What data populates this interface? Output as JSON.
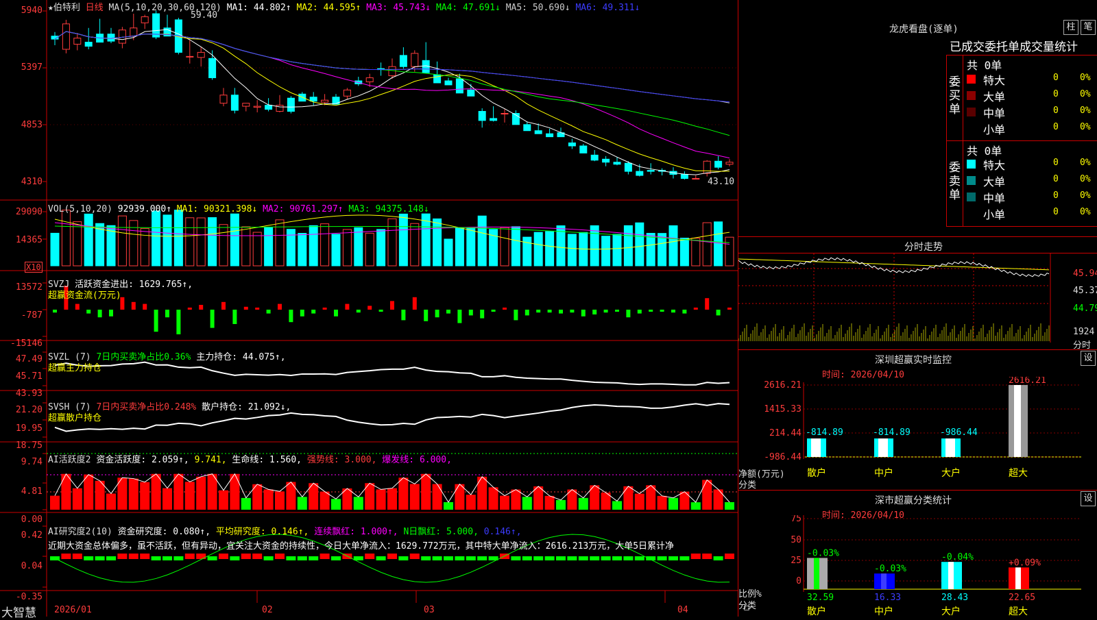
{
  "stock": {
    "name": "★伯特利",
    "period": "日线",
    "star": "★"
  },
  "panel_ma": {
    "title": "MA(5,10,20,30,60,120)",
    "ma1": "MA1: 44.802↑",
    "ma2": "MA2: 44.595↑",
    "ma3": "MA3: 45.743↓",
    "ma4": "MA4: 47.691↓",
    "ma5": "MA5: 50.690↓",
    "ma6": "MA6: 49.311↓",
    "axis": [
      "5940",
      "5397",
      "4853",
      "4310"
    ],
    "high_label": "59.40",
    "low_label": "43.10"
  },
  "panel_vol": {
    "title": "VOL(5,10,20)",
    "value": "92939.000↑",
    "ma1": "MA1: 90321.398↓",
    "ma2": "MA2: 90761.297↑",
    "ma3": "MA3: 94375.148↓",
    "axis": [
      "29090",
      "14365"
    ],
    "unit": "X10"
  },
  "panel_svzj": {
    "title": "SVZJ",
    "label": "活跃资金进出: 1629.765↑,",
    "sub": "超赢资金流(万元)",
    "axis": [
      "13572",
      "-787",
      "-15146"
    ]
  },
  "panel_svzl": {
    "title": "SVZL (7)",
    "l1": "7日内买卖净占比0.36%",
    "l2": "主力持仓: 44.075↑,",
    "sub": "超赢主力持仓",
    "axis": [
      "47.49",
      "45.71",
      "43.93"
    ]
  },
  "panel_svsh": {
    "title": "SVSH (7)",
    "l1": "7日内买卖净占比0.248%",
    "l2": "散户持仓: 21.092↓,",
    "sub": "超赢散户持仓",
    "axis": [
      "21.20",
      "19.95",
      "18.75"
    ]
  },
  "panel_ai1": {
    "title": "AI活跃度2",
    "l1": "资金活跃度: 2.059↑,",
    "l2": "9.741,",
    "l3": "生命线: 1.560,",
    "l4": "强势线: 3.000,",
    "l5": "爆发线: 6.000,",
    "axis": [
      "9.74",
      "4.81",
      "0.00"
    ]
  },
  "panel_ai2": {
    "title": "AI研究度2(10)",
    "l1": "资金研究度: 0.080↑,",
    "l2": "平均研究度: 0.146↑,",
    "l3": "连续飘红: 1.000↑,",
    "l4": "N日飘红: 5.000,",
    "l5": "0.146↑,",
    "note": "近期大资金总体偏多，虽不活跃，但有异动，宜关注大资金的持续性，今日大单净流入：1629.772万元，其中特大单净流入：2616.213万元，大单5日累计净",
    "axis": [
      "0.42",
      "0.04",
      "-0.35"
    ]
  },
  "xaxis": {
    "labels": [
      "2026/01",
      "02",
      "03",
      "04"
    ]
  },
  "brand": "大智慧",
  "lhkp": {
    "title": "龙虎看盘(逐单)",
    "btn1": "柱",
    "btn2": "笔",
    "header": "已成交委托单成交量统计",
    "buy_label": "委买单",
    "sell_label": "委卖单",
    "buy_total": "共 0单",
    "sell_total": "共 0单",
    "buy_rows": [
      {
        "name": "特大",
        "v": "0",
        "p": "0%",
        "color": "#ff0000"
      },
      {
        "name": "大单",
        "v": "0",
        "p": "0%",
        "color": "#8b0000"
      },
      {
        "name": "中单",
        "v": "0",
        "p": "0%",
        "color": "#5a0000"
      },
      {
        "name": "小单",
        "v": "0",
        "p": "0%",
        "color": "#000000"
      }
    ],
    "sell_rows": [
      {
        "name": "特大",
        "v": "0",
        "p": "0%",
        "color": "#00ffff"
      },
      {
        "name": "大单",
        "v": "0",
        "p": "0%",
        "color": "#008b8b"
      },
      {
        "name": "中单",
        "v": "0",
        "p": "0%",
        "color": "#006a6a"
      },
      {
        "name": "小单",
        "v": "0",
        "p": "0%",
        "color": "#000000"
      }
    ]
  },
  "fszs": {
    "title": "分时走势",
    "axis": [
      "45.94",
      "45.37",
      "44.79"
    ],
    "vol": "1924",
    "vol_label": "分时"
  },
  "szcy": {
    "title": "深圳超赢实时监控",
    "btn": "设",
    "time": "时间: 2026/04/10",
    "axis": [
      "2616.21",
      "1415.33",
      "214.44",
      "-986.44"
    ],
    "ylabel": "净额(万元)",
    "xlabel": "分类",
    "bars": [
      {
        "cat": "散户",
        "value": "-814.89"
      },
      {
        "cat": "中户",
        "value": "-814.89"
      },
      {
        "cat": "大户",
        "value": "-986.44"
      },
      {
        "cat": "超大",
        "value": "2616.21"
      }
    ]
  },
  "fltj": {
    "title": "深市超赢分类统计",
    "btn": "设",
    "time": "时间: 2026/04/10",
    "axis": [
      "75",
      "50",
      "25",
      "0"
    ],
    "ylabel": "比例%",
    "xlabel": "分类",
    "bars": [
      {
        "cat": "散户",
        "pct": "32.59",
        "chg": "-0.03%"
      },
      {
        "cat": "中户",
        "pct": "16.33",
        "chg": "-0.03%"
      },
      {
        "cat": "大户",
        "pct": "28.43",
        "chg": "-0.04%"
      },
      {
        "cat": "超大",
        "pct": "22.65",
        "chg": "+0.09%"
      }
    ]
  },
  "chart_data": {
    "type": "candlestick",
    "series": [
      {
        "name": "伯特利",
        "values": [
          [
            57.2,
            57.6,
            56.3,
            56.9
          ],
          [
            55.9,
            58.8,
            55.5,
            58.4
          ],
          [
            56.4,
            57.5,
            55.8,
            57.0
          ],
          [
            56.6,
            58.0,
            55.9,
            56.2
          ],
          [
            57.4,
            58.9,
            56.8,
            56.6
          ],
          [
            57.4,
            58.0,
            56.5,
            56.7
          ],
          [
            56.5,
            58.1,
            56.0,
            57.8
          ],
          [
            57.2,
            59.4,
            56.8,
            58.0
          ],
          [
            58.5,
            59.3,
            57.9,
            59.1
          ],
          [
            59.4,
            59.7,
            56.9,
            57.1
          ],
          [
            58.0,
            59.3,
            57.3,
            57.2
          ],
          [
            58.8,
            59.0,
            55.4,
            55.6
          ],
          [
            55.2,
            56.8,
            54.5,
            55.2
          ],
          [
            55.1,
            56.1,
            54.2,
            55.6
          ],
          [
            55.0,
            55.8,
            52.9,
            53.1
          ],
          [
            50.6,
            52.1,
            50.3,
            51.4
          ],
          [
            51.4,
            52.1,
            49.6,
            49.9
          ],
          [
            50.3,
            50.6,
            49.8,
            50.6
          ],
          [
            50.2,
            50.9,
            49.7,
            50.3
          ],
          [
            50.4,
            51.1,
            49.8,
            50.0
          ],
          [
            49.8,
            51.4,
            49.7,
            50.4
          ],
          [
            51.1,
            51.3,
            49.6,
            49.8
          ],
          [
            51.5,
            51.7,
            50.8,
            50.8
          ],
          [
            51.2,
            51.7,
            50.4,
            50.8
          ],
          [
            50.7,
            51.5,
            50.4,
            50.9
          ],
          [
            51.2,
            51.5,
            50.5,
            50.5
          ],
          [
            51.3,
            52.1,
            51.0,
            51.9
          ],
          [
            52.8,
            53.2,
            52.3,
            52.5
          ],
          [
            52.7,
            53.5,
            52.2,
            53.1
          ],
          [
            54.0,
            54.6,
            53.3,
            53.9
          ],
          [
            53.3,
            55.0,
            53.0,
            54.2
          ],
          [
            55.3,
            56.1,
            54.0,
            54.2
          ],
          [
            54.2,
            55.8,
            53.7,
            55.5
          ],
          [
            54.8,
            56.6,
            53.9,
            53.6
          ],
          [
            53.4,
            54.7,
            52.9,
            52.6
          ],
          [
            52.8,
            53.1,
            52.4,
            52.4
          ],
          [
            53.0,
            53.5,
            52.0,
            51.6
          ],
          [
            51.9,
            52.5,
            51.4,
            51.3
          ],
          [
            49.8,
            50.1,
            48.2,
            48.9
          ],
          [
            49.1,
            50.3,
            48.8,
            48.9
          ],
          [
            49.6,
            50.0,
            48.7,
            49.6
          ],
          [
            49.6,
            49.9,
            48.9,
            48.5
          ],
          [
            48.5,
            48.8,
            47.9,
            47.9
          ],
          [
            47.9,
            48.6,
            47.6,
            47.6
          ],
          [
            47.6,
            48.1,
            47.4,
            47.3
          ],
          [
            47.7,
            48.2,
            47.3,
            47.3
          ],
          [
            46.7,
            47.1,
            46.1,
            46.4
          ],
          [
            46.4,
            46.6,
            45.8,
            45.7
          ],
          [
            45.5,
            46.0,
            44.9,
            45.0
          ],
          [
            45.1,
            45.4,
            44.4,
            44.8
          ],
          [
            44.8,
            45.3,
            44.5,
            44.6
          ],
          [
            44.7,
            44.9,
            43.6,
            43.9
          ],
          [
            43.9,
            44.6,
            43.4,
            43.5
          ],
          [
            44.0,
            44.7,
            43.6,
            43.9
          ],
          [
            44.0,
            44.2,
            43.5,
            43.9
          ],
          [
            43.9,
            44.3,
            43.2,
            43.6
          ],
          [
            43.6,
            43.9,
            43.1,
            43.2
          ],
          [
            43.2,
            43.5,
            43.1,
            43.2
          ],
          [
            43.7,
            45.0,
            43.4,
            44.9
          ],
          [
            44.9,
            45.4,
            44.1,
            44.3
          ],
          [
            44.6,
            45.1,
            44.4,
            44.8
          ]
        ]
      }
    ],
    "note": "values are [open, high, low, close] per day; axis range 43.10-59.40"
  }
}
